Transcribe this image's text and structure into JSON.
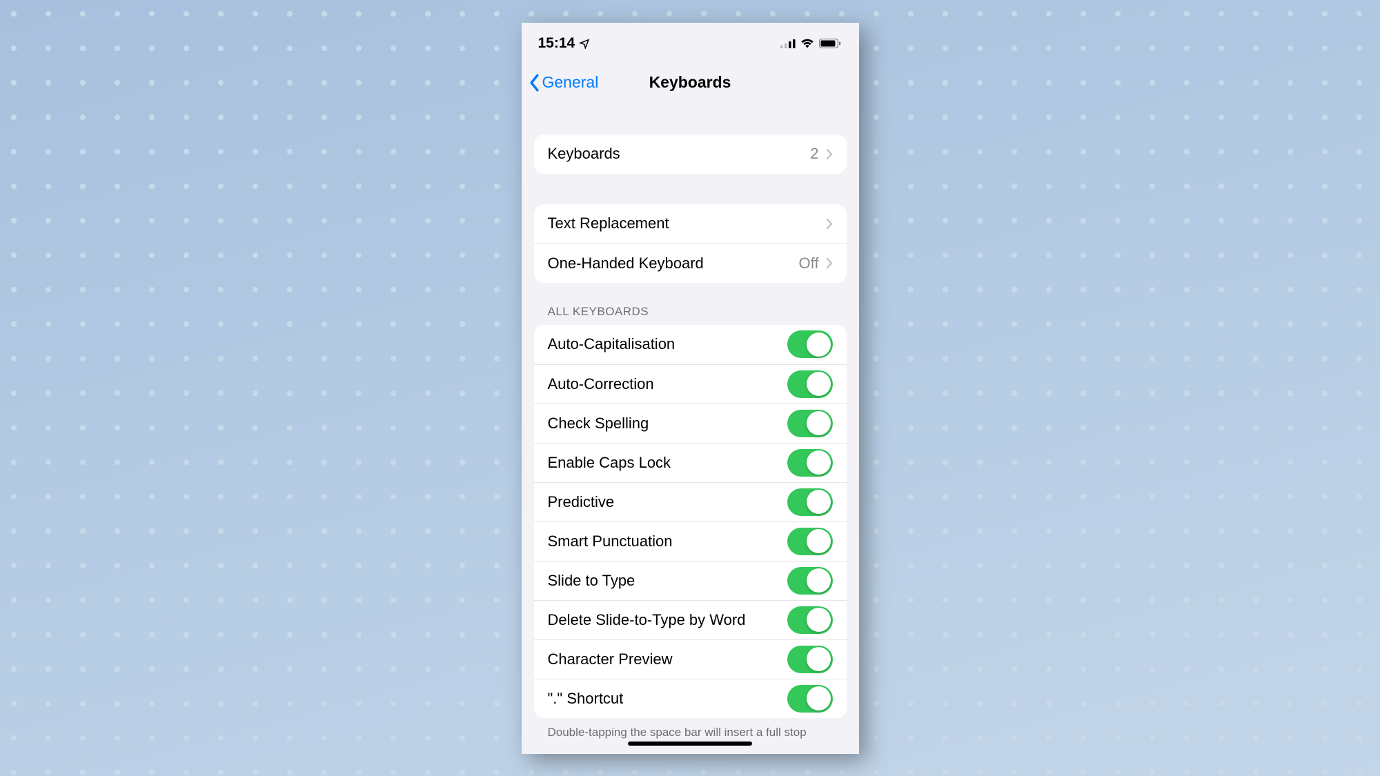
{
  "status": {
    "time": "15:14"
  },
  "nav": {
    "back_label": "General",
    "title": "Keyboards"
  },
  "section1": {
    "keyboards_label": "Keyboards",
    "keyboards_count": "2"
  },
  "section2": {
    "text_replacement_label": "Text Replacement",
    "one_handed_label": "One-Handed Keyboard",
    "one_handed_value": "Off"
  },
  "section3": {
    "header": "ALL KEYBOARDS",
    "toggles": [
      {
        "label": "Auto-Capitalisation",
        "on": true
      },
      {
        "label": "Auto-Correction",
        "on": true
      },
      {
        "label": "Check Spelling",
        "on": true
      },
      {
        "label": "Enable Caps Lock",
        "on": true
      },
      {
        "label": "Predictive",
        "on": true
      },
      {
        "label": "Smart Punctuation",
        "on": true
      },
      {
        "label": "Slide to Type",
        "on": true
      },
      {
        "label": "Delete Slide-to-Type by Word",
        "on": true
      },
      {
        "label": "Character Preview",
        "on": true
      },
      {
        "label": "\".\" Shortcut",
        "on": true
      }
    ],
    "footer": "Double-tapping the space bar will insert a full stop"
  }
}
